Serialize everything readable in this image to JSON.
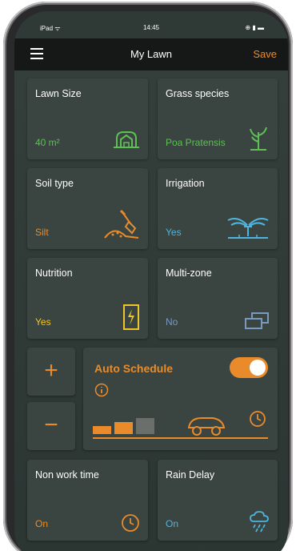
{
  "status_bar": {
    "carrier": "iPad ᯤ",
    "time": "14:45",
    "indicators": "⊕ ▮ ▬"
  },
  "header": {
    "title": "My Lawn",
    "save_label": "Save"
  },
  "tiles": {
    "lawn_size": {
      "label": "Lawn Size",
      "value": "40 m²"
    },
    "grass_species": {
      "label": "Grass species",
      "value": "Poa Pratensis"
    },
    "soil_type": {
      "label": "Soil type",
      "value": "Silt"
    },
    "irrigation": {
      "label": "Irrigation",
      "value": "Yes"
    },
    "nutrition": {
      "label": "Nutrition",
      "value": "Yes"
    },
    "multi_zone": {
      "label": "Multi-zone",
      "value": "No"
    },
    "non_work_time": {
      "label": "Non work time",
      "value": "On"
    },
    "rain_delay": {
      "label": "Rain Delay",
      "value": "On"
    }
  },
  "schedule": {
    "title": "Auto Schedule",
    "toggle_on": true,
    "increase_label": "+",
    "decrease_label": "−",
    "level": 2,
    "level_max": 3
  },
  "colors": {
    "accent": "#e98b2a",
    "green": "#5fbf56",
    "yellow": "#f0c52c",
    "blue": "#4fb4de"
  },
  "icons": {
    "menu": "hamburger-icon",
    "lawn_size": "lawn-area-icon",
    "grass": "grass-sprout-icon",
    "soil": "shovel-soil-icon",
    "irrigation": "sprinkler-icon",
    "nutrition": "fertilizer-bag-icon",
    "multi_zone": "stacked-zones-icon",
    "info": "info-icon",
    "mower": "robot-mower-icon",
    "clock": "clock-icon",
    "rain": "rain-cloud-icon"
  }
}
